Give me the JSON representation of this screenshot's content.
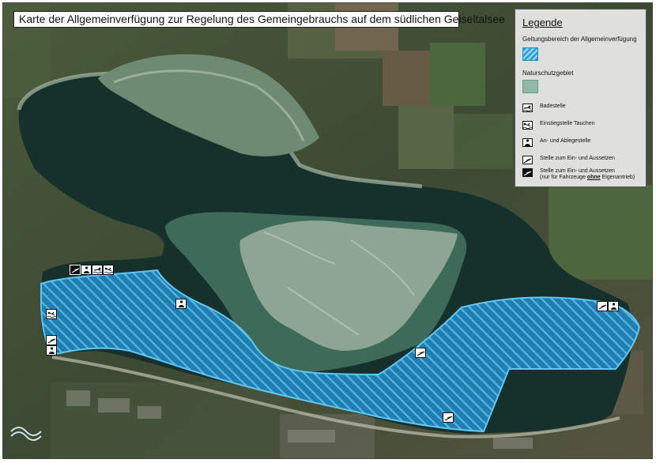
{
  "title": "Karte der Allgemeinverfügung zur Regelung des Gemeingebrauchs auf dem südlichen Geiseltalsee",
  "legend": {
    "heading": "Legende",
    "scope_label": "Geltungsbereich der Allgemeinverfügung",
    "nature_label": "Naturschutzgebiet",
    "items": [
      {
        "icon": "swimmer-icon",
        "label": "Badestelle"
      },
      {
        "icon": "diver-icon",
        "label": "Einstiegstelle Tauchen"
      },
      {
        "icon": "anchor-person-icon",
        "label": "An- und Ablegestelle"
      },
      {
        "icon": "boat-slip-icon",
        "label": "Stelle zum Ein- und Aussetzen"
      },
      {
        "icon": "boat-slip-dark-icon",
        "label": "Stelle zum Ein- und Aussetzen",
        "note_before": "(nur für Fahrzeuge ",
        "note_bold": "ohne",
        "note_after": " Eigenantrieb)"
      }
    ]
  },
  "colors": {
    "scope_fill": "#1a7fb0",
    "scope_border": "#59c4f0",
    "nature_fill": "#3f6e5c",
    "lake": "#16302c"
  }
}
